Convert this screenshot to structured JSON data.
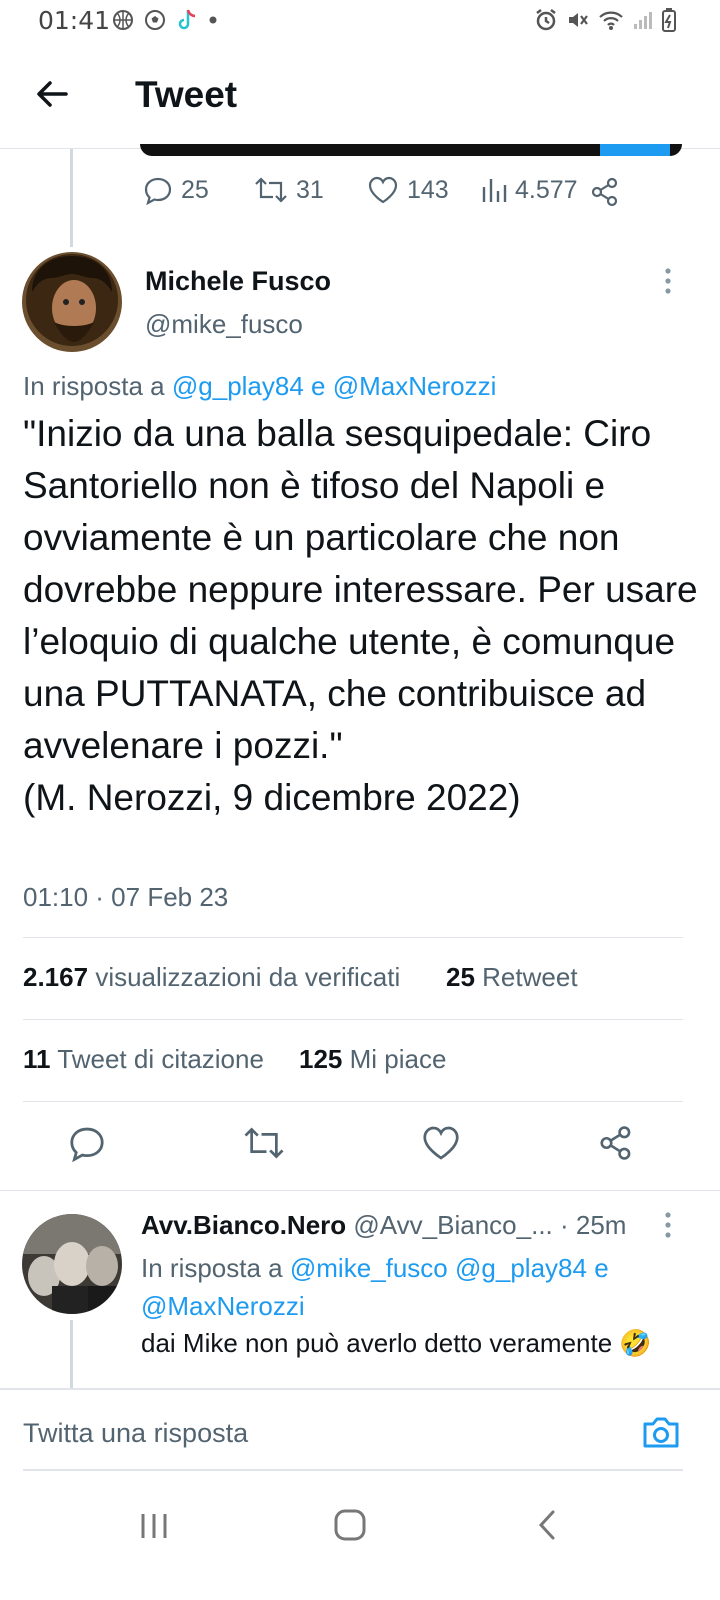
{
  "status_bar": {
    "time": "01:41"
  },
  "header": {
    "title": "Tweet"
  },
  "prev_tweet": {
    "actions": {
      "replies": "25",
      "retweets": "31",
      "likes": "143",
      "views": "4.577"
    }
  },
  "tweet": {
    "author_name": "Michele Fusco",
    "author_handle": "@mike_fusco",
    "reply_prefix": "In risposta a",
    "reply_to_1": "@g_play84",
    "reply_joiner": "e",
    "reply_to_2": "@MaxNerozzi",
    "text": "\"Inizio da una balla sesquipedale: Ciro Santoriello non è tifoso del Napoli e ovviamente è un particolare che non dovrebbe neppure interessare. Per usare l’eloquio di qualche utente, è comunque una PUTTANATA, che contribuisce ad avvelenare i pozzi.\"\n(M. Nerozzi, 9 dicembre 2022)",
    "timestamp": "01:10 · 07 Feb 23",
    "stats": {
      "views_value": "2.167",
      "views_label": "visualizzazioni da verificati",
      "retweets_value": "25",
      "retweets_label": "Retweet",
      "quotes_value": "11",
      "quotes_label": "Tweet di citazione",
      "likes_value": "125",
      "likes_label": "Mi piace"
    }
  },
  "reply": {
    "author_name": "Avv.Bianco.Nero",
    "author_handle": "@Avv_Bianco_...",
    "age": "· 25m",
    "reply_prefix": "In risposta a",
    "reply_to_1": "@mike_fusco",
    "reply_to_2": "@g_play84",
    "reply_joiner": "e",
    "reply_to_3": "@MaxNerozzi",
    "text": "dai Mike non può averlo detto veramente",
    "emoji": "🤣"
  },
  "compose": {
    "placeholder": "Twitta una risposta"
  },
  "colors": {
    "accent": "#1d9bf0",
    "secondary_text": "#536471",
    "divider": "#e1e4e8"
  },
  "icons": [
    "arrow-left-icon",
    "reply-icon",
    "retweet-icon",
    "like-icon",
    "views-icon",
    "share-icon",
    "more-icon",
    "camera-icon",
    "recent-apps-icon",
    "home-icon",
    "back-nav-icon"
  ]
}
